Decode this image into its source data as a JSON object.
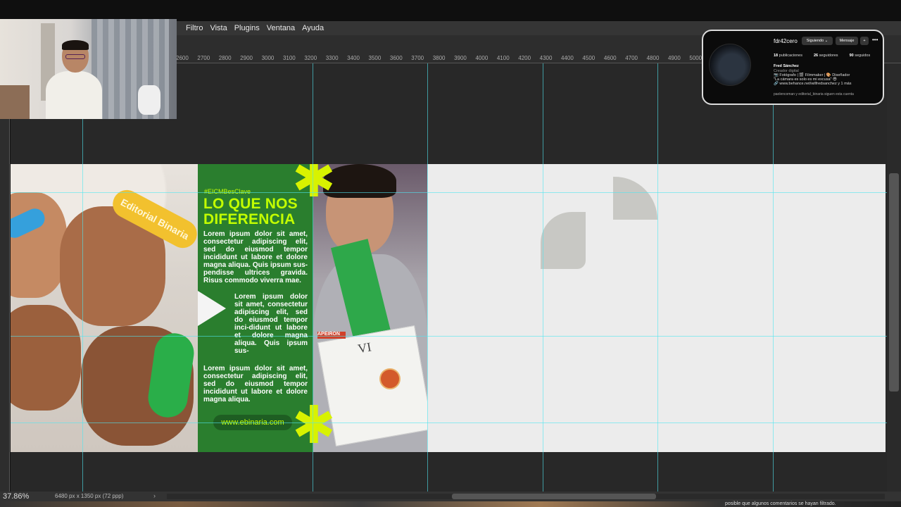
{
  "menu": {
    "items": [
      "Filtro",
      "Vista",
      "Plugins",
      "Ventana",
      "Ayuda"
    ]
  },
  "ruler": {
    "labels": [
      "2600",
      "2700",
      "2800",
      "2900",
      "3000",
      "3100",
      "3200",
      "3300",
      "3400",
      "3500",
      "3600",
      "3700",
      "3800",
      "3900",
      "4000",
      "4100",
      "4200",
      "4300",
      "4400",
      "4500",
      "4600",
      "4700",
      "4800",
      "4900",
      "5000"
    ]
  },
  "design": {
    "hashtag": "#EICMBesClave",
    "headline_line1": "LO QUE NOS",
    "headline_line2": "DIFERENCIA",
    "paragraph1": "Lorem ipsum dolor sit amet, consectetur adipiscing elit, sed do eiusmod tempor incididunt ut labore et dolore magna aliqua. Quis ipsum sus-pendisse ultrices gravida. Risus commodo viverra mae.",
    "paragraph2": "Lorem ipsum dolor sit amet, consectetur adipiscing elit, sed do eiusmod tempor inci-didunt ut labore et dolore magna aliqua. Quis ipsum sus-",
    "paragraph3": "Lorem ipsum dolor sit amet, consectetur adipiscing elit, sed do eiusmod tempor incididunt ut labore et dolore magna aliqua.",
    "website": "www.ebinaria.com",
    "band_text": "Editorial Binaria",
    "boy_badge": "APEIRON",
    "cert_title": "VI"
  },
  "instagram": {
    "username": "fdr42cero",
    "follow_label": "Siguiendo ⌄",
    "message_label": "Mensaje",
    "add_label": "+",
    "more_label": "•••",
    "posts_count": "18",
    "posts_label": "publicaciones",
    "followers_count": "26",
    "followers_label": "seguidores",
    "following_count": "90",
    "following_label": "seguidos",
    "display_name": "Fred Sánchez",
    "category": "Creador digital",
    "bio_line1": "📷 Fotógrafo | 🎬 Filmmaker | 🎨 Diseñador",
    "bio_line2": "\"La cámara es solo es mi excusa\" 😎",
    "bio_line3": "🔗 www.behance.net/wilfredsanchez y 1 más",
    "followed_by": "paolencoman y editorial_binaria siguen esta cuenta"
  },
  "status": {
    "zoom": "37.86%",
    "doc_info": "6480 px x 1350 px (72 ppp)",
    "arrow": "›",
    "comment_note": "posible que algunos comentarios se hayan filtrado."
  },
  "colors": {
    "accent_lime": "#c3ff00",
    "panel_green": "#2a7e2e",
    "guide": "#50e6f0"
  }
}
